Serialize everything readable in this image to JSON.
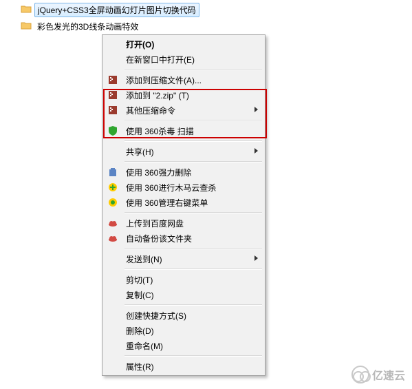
{
  "folders": [
    {
      "name": "jQuery+CSS3全屏动画幻灯片图片切换代码",
      "selected": true
    },
    {
      "name": "彩色发光的3D线条动画特效",
      "selected": false
    }
  ],
  "menu": {
    "open": "打开(O)",
    "open_new_window": "在新窗口中打开(E)",
    "add_to_archive": "添加到压缩文件(A)...",
    "add_to_zip": "添加到 \"2.zip\" (T)",
    "other_compress": "其他压缩命令",
    "scan_360": "使用 360杀毒 扫描",
    "share": "共享(H)",
    "force_delete_360": "使用 360强力删除",
    "trojan_scan_360": "使用 360进行木马云查杀",
    "rightclick_360": "使用 360管理右键菜单",
    "upload_baidu": "上传到百度网盘",
    "auto_backup": "自动备份该文件夹",
    "send_to": "发送到(N)",
    "cut": "剪切(T)",
    "copy": "复制(C)",
    "create_shortcut": "创建快捷方式(S)",
    "delete": "删除(D)",
    "rename": "重命名(M)",
    "properties": "属性(R)"
  },
  "watermark": "亿速云"
}
